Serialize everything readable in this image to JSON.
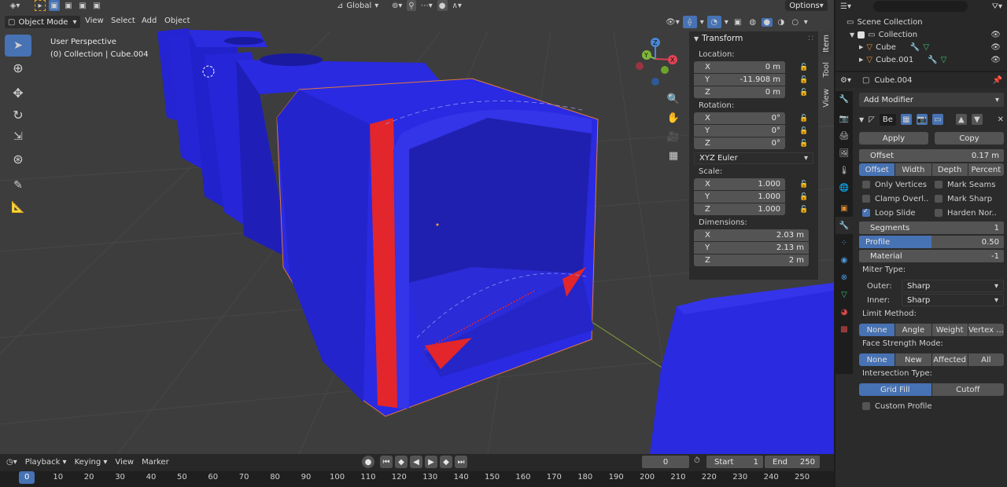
{
  "header": {
    "mode": "Object Mode",
    "menus": [
      "View",
      "Select",
      "Add",
      "Object"
    ],
    "orientation": "Global",
    "options": "Options"
  },
  "viewport": {
    "perspective": "User Perspective",
    "collection": "(0) Collection | Cube.004",
    "gizmo": {
      "x": "X",
      "y": "Y",
      "z": "Z"
    }
  },
  "transform": {
    "title": "Transform",
    "location_label": "Location:",
    "location": [
      {
        "axis": "X",
        "value": "0 m"
      },
      {
        "axis": "Y",
        "value": "-11.908 m"
      },
      {
        "axis": "Z",
        "value": "0 m"
      }
    ],
    "rotation_label": "Rotation:",
    "rotation": [
      {
        "axis": "X",
        "value": "0°"
      },
      {
        "axis": "Y",
        "value": "0°"
      },
      {
        "axis": "Z",
        "value": "0°"
      }
    ],
    "rotation_mode": "XYZ Euler",
    "scale_label": "Scale:",
    "scale": [
      {
        "axis": "X",
        "value": "1.000"
      },
      {
        "axis": "Y",
        "value": "1.000"
      },
      {
        "axis": "Z",
        "value": "1.000"
      }
    ],
    "dimensions_label": "Dimensions:",
    "dimensions": [
      {
        "axis": "X",
        "value": "2.03 m"
      },
      {
        "axis": "Y",
        "value": "2.13 m"
      },
      {
        "axis": "Z",
        "value": "2 m"
      }
    ]
  },
  "side_tabs": [
    "Item",
    "Tool",
    "View"
  ],
  "outliner": {
    "scene_collection": "Scene Collection",
    "collection": "Collection",
    "items": [
      "Cube",
      "Cube.001"
    ]
  },
  "properties": {
    "object_name": "Cube.004",
    "add_modifier": "Add Modifier",
    "modifier_name": "Be",
    "apply": "Apply",
    "copy": "Copy",
    "offset_label": "Offset",
    "offset_value": "0.17 m",
    "width_type": [
      "Offset",
      "Width",
      "Depth",
      "Percent"
    ],
    "checks": [
      {
        "label": "Only Vertices",
        "on": false
      },
      {
        "label": "Mark Seams",
        "on": false
      },
      {
        "label": "Clamp Overl..",
        "on": false
      },
      {
        "label": "Mark Sharp",
        "on": false
      },
      {
        "label": "Loop Slide",
        "on": true
      },
      {
        "label": "Harden Nor..",
        "on": false
      }
    ],
    "segments_label": "Segments",
    "segments_value": "1",
    "profile_label": "Profile",
    "profile_value": "0.50",
    "profile_fraction": 0.5,
    "material_label": "Material",
    "material_value": "-1",
    "miter_type": "Miter Type:",
    "outer_label": "Outer:",
    "outer_value": "Sharp",
    "inner_label": "Inner:",
    "inner_value": "Sharp",
    "limit_method": "Limit Method:",
    "limit_options": [
      "None",
      "Angle",
      "Weight",
      "Vertex ..."
    ],
    "face_strength": "Face Strength Mode:",
    "face_options": [
      "None",
      "New",
      "Affected",
      "All"
    ],
    "intersection": "Intersection Type:",
    "intersection_options": [
      "Grid Fill",
      "Cutoff"
    ],
    "custom_profile": "Custom Profile"
  },
  "timeline": {
    "menus": [
      "Playback",
      "Keying",
      "View",
      "Marker"
    ],
    "current_frame": "0",
    "start_label": "Start",
    "start": "1",
    "end_label": "End",
    "end": "250",
    "ticks": [
      "0",
      "10",
      "20",
      "30",
      "40",
      "50",
      "60",
      "70",
      "80",
      "90",
      "100",
      "110",
      "120",
      "130",
      "140",
      "150",
      "160",
      "170",
      "180",
      "190",
      "200",
      "210",
      "220",
      "230",
      "240",
      "250"
    ]
  },
  "colors": {
    "accent": "#4772b3",
    "mesh": "#2b2bd9",
    "mesh_dark": "#1f1fa8",
    "edge_select": "#e0282b",
    "bg": "#3d3d3d"
  }
}
